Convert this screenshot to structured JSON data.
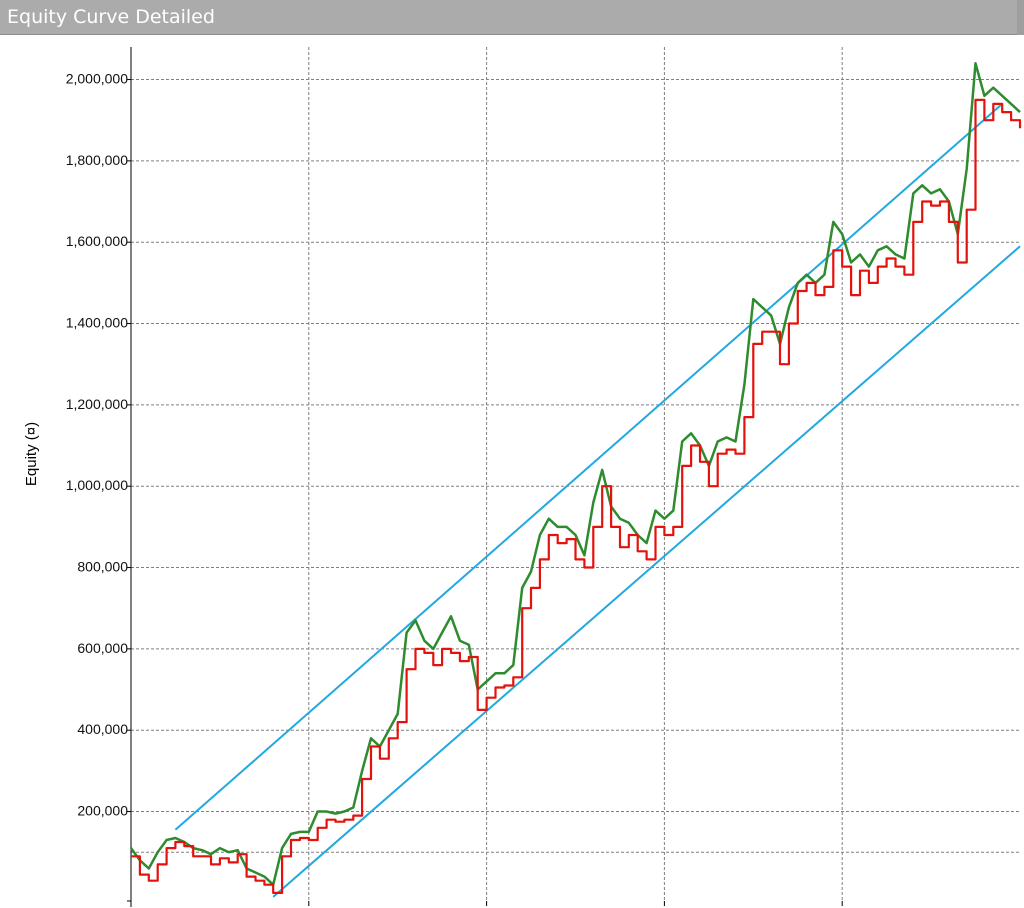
{
  "window": {
    "title": "Equity Curve Detailed"
  },
  "chart_data": {
    "type": "line",
    "title": "",
    "ylabel": "Equity (¤)",
    "xlabel": "",
    "ylim": [
      -20000,
      2080000
    ],
    "xlim": [
      0,
      100
    ],
    "yticks": [
      {
        "value": 200000,
        "label": "200,000"
      },
      {
        "value": 400000,
        "label": "400,000"
      },
      {
        "value": 600000,
        "label": "600,000"
      },
      {
        "value": 800000,
        "label": "800,000"
      },
      {
        "value": 1000000,
        "label": "1,000,000"
      },
      {
        "value": 1200000,
        "label": "1,200,000"
      },
      {
        "value": 1400000,
        "label": "1,400,000"
      },
      {
        "value": 1600000,
        "label": "1,600,000"
      },
      {
        "value": 1800000,
        "label": "1,800,000"
      },
      {
        "value": 2000000,
        "label": "2,000,000"
      }
    ],
    "xgrid": [
      20,
      40,
      60,
      80
    ],
    "grid": true,
    "colors": {
      "equity": "#e4120c",
      "highs": "#2e8b2e",
      "channel": "#21a8e0",
      "grid": "#808080"
    },
    "series": [
      {
        "role": "equity",
        "x": [
          0,
          1,
          2,
          3,
          4,
          5,
          6,
          7,
          8,
          9,
          10,
          11,
          12,
          13,
          14,
          15,
          16,
          17,
          18,
          19,
          20,
          21,
          22,
          23,
          24,
          25,
          26,
          27,
          28,
          29,
          30,
          31,
          32,
          33,
          34,
          35,
          36,
          37,
          38,
          39,
          40,
          41,
          42,
          43,
          44,
          45,
          46,
          47,
          48,
          49,
          50,
          51,
          52,
          53,
          54,
          55,
          56,
          57,
          58,
          59,
          60,
          61,
          62,
          63,
          64,
          65,
          66,
          67,
          68,
          69,
          70,
          71,
          72,
          73,
          74,
          75,
          76,
          77,
          78,
          79,
          80,
          81,
          82,
          83,
          84,
          85,
          86,
          87,
          88,
          89,
          90,
          91,
          92,
          93,
          94,
          95,
          96,
          97,
          98,
          99,
          100
        ],
        "y": [
          90000,
          45000,
          30000,
          70000,
          110000,
          125000,
          115000,
          90000,
          90000,
          70000,
          85000,
          75000,
          95000,
          40000,
          30000,
          20000,
          0,
          90000,
          130000,
          135000,
          130000,
          160000,
          180000,
          175000,
          180000,
          190000,
          280000,
          360000,
          330000,
          380000,
          420000,
          550000,
          600000,
          590000,
          560000,
          600000,
          590000,
          570000,
          580000,
          450000,
          480000,
          505000,
          510000,
          530000,
          700000,
          750000,
          820000,
          880000,
          860000,
          870000,
          820000,
          800000,
          900000,
          1000000,
          900000,
          850000,
          880000,
          840000,
          820000,
          900000,
          880000,
          900000,
          1050000,
          1100000,
          1060000,
          1000000,
          1080000,
          1090000,
          1080000,
          1170000,
          1350000,
          1380000,
          1380000,
          1300000,
          1400000,
          1480000,
          1500000,
          1470000,
          1490000,
          1580000,
          1540000,
          1470000,
          1530000,
          1500000,
          1540000,
          1560000,
          1540000,
          1520000,
          1650000,
          1700000,
          1690000,
          1700000,
          1650000,
          1550000,
          1680000,
          1950000,
          1900000,
          1940000,
          1920000,
          1900000,
          1880000
        ]
      },
      {
        "role": "highs",
        "x": [
          0,
          1,
          2,
          3,
          4,
          5,
          6,
          7,
          8,
          9,
          10,
          11,
          12,
          13,
          14,
          15,
          16,
          17,
          18,
          19,
          20,
          21,
          22,
          23,
          24,
          25,
          26,
          27,
          28,
          29,
          30,
          31,
          32,
          33,
          34,
          35,
          36,
          37,
          38,
          39,
          40,
          41,
          42,
          43,
          44,
          45,
          46,
          47,
          48,
          49,
          50,
          51,
          52,
          53,
          54,
          55,
          56,
          57,
          58,
          59,
          60,
          61,
          62,
          63,
          64,
          65,
          66,
          67,
          68,
          69,
          70,
          71,
          72,
          73,
          74,
          75,
          76,
          77,
          78,
          79,
          80,
          81,
          82,
          83,
          84,
          85,
          86,
          87,
          88,
          89,
          90,
          91,
          92,
          93,
          94,
          95,
          96,
          97,
          98,
          99,
          100
        ],
        "y": [
          110000,
          80000,
          60000,
          100000,
          130000,
          135000,
          125000,
          110000,
          105000,
          95000,
          110000,
          100000,
          105000,
          60000,
          50000,
          40000,
          20000,
          110000,
          145000,
          150000,
          150000,
          200000,
          200000,
          195000,
          200000,
          210000,
          300000,
          380000,
          360000,
          400000,
          440000,
          640000,
          670000,
          620000,
          600000,
          640000,
          680000,
          620000,
          610000,
          500000,
          520000,
          540000,
          540000,
          560000,
          750000,
          790000,
          880000,
          920000,
          900000,
          900000,
          880000,
          830000,
          960000,
          1040000,
          950000,
          920000,
          910000,
          880000,
          860000,
          940000,
          920000,
          940000,
          1110000,
          1130000,
          1100000,
          1050000,
          1110000,
          1120000,
          1110000,
          1250000,
          1460000,
          1440000,
          1420000,
          1350000,
          1440000,
          1500000,
          1520000,
          1500000,
          1520000,
          1650000,
          1620000,
          1550000,
          1570000,
          1540000,
          1580000,
          1590000,
          1570000,
          1560000,
          1720000,
          1740000,
          1720000,
          1730000,
          1700000,
          1620000,
          1780000,
          2040000,
          1960000,
          1980000,
          1960000,
          1940000,
          1920000
        ]
      },
      {
        "role": "channel-upper",
        "x": [
          5,
          98
        ],
        "y": [
          155000,
          1940000
        ]
      },
      {
        "role": "channel-lower",
        "x": [
          16,
          100
        ],
        "y": [
          -10000,
          1590000
        ]
      }
    ]
  }
}
